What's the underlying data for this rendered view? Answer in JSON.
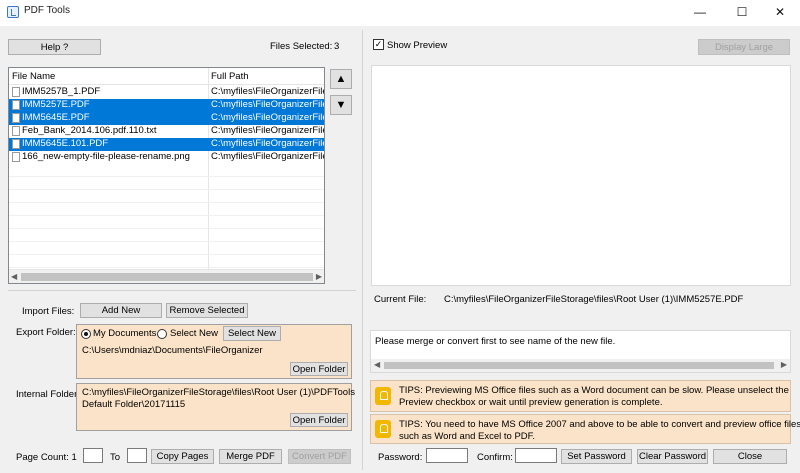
{
  "window": {
    "title": "PDF Tools",
    "minimize": "—",
    "maximize": "☐",
    "close": "✕"
  },
  "left": {
    "help_label": "Help ?",
    "files_selected_label": "Files Selected:",
    "files_selected_count": "3",
    "columns": [
      "File Name",
      "Full Path"
    ],
    "files": [
      {
        "name": "IMM5257B_1.PDF",
        "path": "C:\\myfiles\\FileOrganizerFileStorage",
        "selected": false
      },
      {
        "name": "IMM5257E.PDF",
        "path": "C:\\myfiles\\FileOrganizerFileStorage",
        "selected": true
      },
      {
        "name": "IMM5645E.PDF",
        "path": "C:\\myfiles\\FileOrganizerFileStorage",
        "selected": true
      },
      {
        "name": "Feb_Bank_2014.106.pdf.110.txt",
        "path": "C:\\myfiles\\FileOrganizerFileStorage",
        "selected": false
      },
      {
        "name": "IMM5645E.101.PDF",
        "path": "C:\\myfiles\\FileOrganizerFileStorage",
        "selected": true
      },
      {
        "name": "166_new-empty-file-please-rename.png",
        "path": "C:\\myfiles\\FileOrganizerFileStorage",
        "selected": false
      }
    ],
    "move_up": "▲",
    "move_down": "▼",
    "import_label": "Import Files:",
    "add_new": "Add New",
    "remove_selected": "Remove Selected",
    "export_label": "Export Folder:",
    "my_documents": "My Documents",
    "select_new_radio": "Select New",
    "select_new_button": "Select New",
    "export_path": "C:\\Users\\mdniaz\\Documents\\FileOrganizer",
    "open_folder_1": "Open Folder",
    "internal_label": "Internal Folder:",
    "internal_path_1": "C:\\myfiles\\FileOrganizerFileStorage\\files\\Root User (1)\\PDFTools",
    "internal_path_2": "Default Folder\\20171115",
    "open_folder_2": "Open Folder",
    "page_count_label": "Page Count: 1",
    "to_label": "To",
    "copy_pages": "Copy Pages",
    "merge_pdf": "Merge PDF",
    "convert_pdf": "Convert PDF"
  },
  "right": {
    "show_preview": "Show Preview",
    "show_preview_checked": "✓",
    "display_large": "Display Large",
    "current_file_label": "Current File:",
    "current_file_value": "C:\\myfiles\\FileOrganizerFileStorage\\files\\Root User (1)\\IMM5257E.PDF",
    "merge_hint": "Please merge or convert first to see name of the new file.",
    "tip1_line1": "TIPS: Previewing MS Office files such as a Word document can be slow. Please unselect the",
    "tip1_line2": "Preview checkbox or wait until preview generation is complete.",
    "tip2_line1": "TIPS: You need to have MS Office 2007 and above to be able to convert and preview office files",
    "tip2_line2": "such as Word and Excel to PDF.",
    "password_label": "Password:",
    "confirm_label": "Confirm:",
    "set_password": "Set Password",
    "clear_password": "Clear Password",
    "close": "Close"
  }
}
